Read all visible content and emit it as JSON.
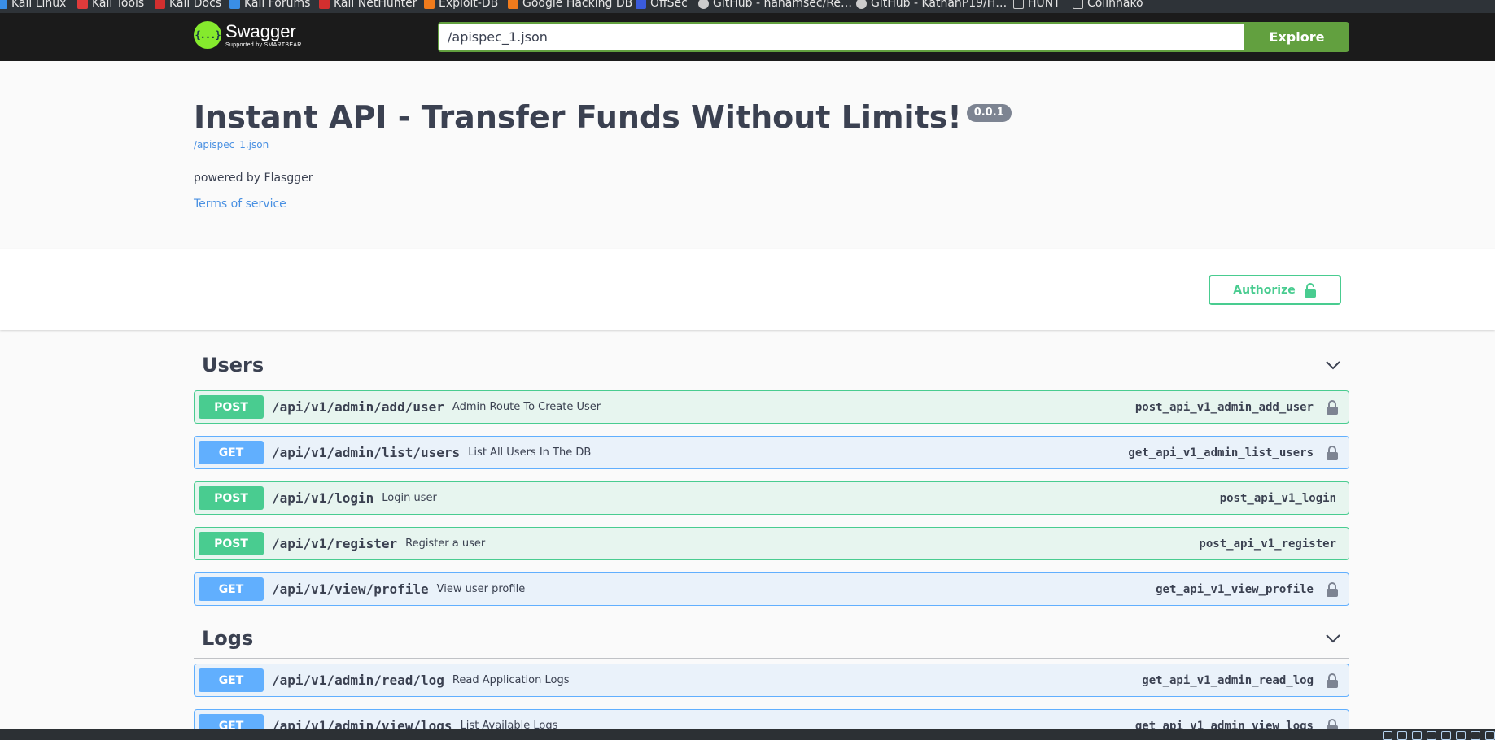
{
  "browser": {
    "bookmarks": [
      {
        "label": "Kali Linux",
        "icon": "kali-dragon-icon",
        "color": "#3a8ee6"
      },
      {
        "label": "Kali Tools",
        "icon": "kali-tools-icon",
        "color": "#e03b3b"
      },
      {
        "label": "Kali Docs",
        "icon": "kali-docs-icon",
        "color": "#d32f2f"
      },
      {
        "label": "Kali Forums",
        "icon": "kali-forums-icon",
        "color": "#3a8ee6"
      },
      {
        "label": "Kali NetHunter",
        "icon": "nethunter-icon",
        "color": "#d32f2f"
      },
      {
        "label": "Exploit-DB",
        "icon": "exploit-db-icon",
        "color": "#f07b1c"
      },
      {
        "label": "Google Hacking DB",
        "icon": "ghdb-icon",
        "color": "#f07b1c"
      },
      {
        "label": "OffSec",
        "icon": "offsec-icon",
        "color": "#3b5bdb"
      },
      {
        "label": "GitHub - hahamsec/Re…",
        "icon": "github-icon",
        "color": "#cccccc"
      },
      {
        "label": "GitHub - KathanP19/H…",
        "icon": "github-icon",
        "color": "#cccccc"
      },
      {
        "label": "HUNT",
        "icon": "folder-icon",
        "color": "#cccccc"
      },
      {
        "label": "Colinhako",
        "icon": "folder-icon",
        "color": "#cccccc"
      }
    ]
  },
  "topbar": {
    "logo_name": "Swagger",
    "logo_sub": "Supported by SMARTBEAR",
    "logo_glyph": "{...}",
    "url_value": "/apispec_1.json",
    "explore_label": "Explore",
    "accent": "#62a03f"
  },
  "info": {
    "title": "Instant API - Transfer Funds Without Limits!",
    "version": "0.0.1",
    "spec_link": "/apispec_1.json",
    "description": "powered by Flasgger",
    "terms_label": "Terms of service"
  },
  "scheme": {
    "authorize_label": "Authorize",
    "authorize_icon": "unlocked-padlock-icon"
  },
  "colors": {
    "post": "#49cc90",
    "get": "#61affe",
    "text": "#3b4151",
    "link": "#4990e2"
  },
  "tags": [
    {
      "name": "Users",
      "operations": [
        {
          "method": "POST",
          "path": "/api/v1/admin/add/user",
          "summary": "Admin Route To Create User",
          "operation_id": "post_api_v1_admin_add_user",
          "locked": true
        },
        {
          "method": "GET",
          "path": "/api/v1/admin/list/users",
          "summary": "List All Users In The DB",
          "operation_id": "get_api_v1_admin_list_users",
          "locked": true
        },
        {
          "method": "POST",
          "path": "/api/v1/login",
          "summary": "Login user",
          "operation_id": "post_api_v1_login",
          "locked": false
        },
        {
          "method": "POST",
          "path": "/api/v1/register",
          "summary": "Register a user",
          "operation_id": "post_api_v1_register",
          "locked": false
        },
        {
          "method": "GET",
          "path": "/api/v1/view/profile",
          "summary": "View user profile",
          "operation_id": "get_api_v1_view_profile",
          "locked": true
        }
      ]
    },
    {
      "name": "Logs",
      "operations": [
        {
          "method": "GET",
          "path": "/api/v1/admin/read/log",
          "summary": "Read Application Logs",
          "operation_id": "get_api_v1_admin_read_log",
          "locked": true
        },
        {
          "method": "GET",
          "path": "/api/v1/admin/view/logs",
          "summary": "List Available Logs",
          "operation_id": "get_api_v1_admin_view_logs",
          "locked": true
        }
      ]
    }
  ]
}
